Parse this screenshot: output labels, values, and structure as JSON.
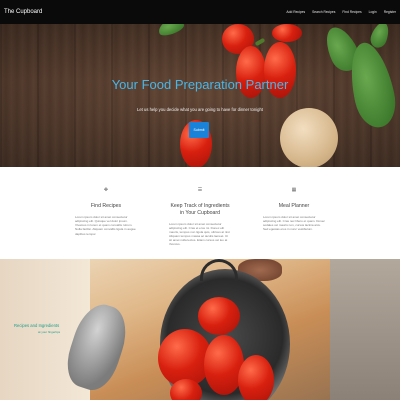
{
  "navbar": {
    "brand": "The Cupboard",
    "links": [
      "Add Recipes",
      "Search Recipes",
      "Find Recipes",
      "Login",
      "Register"
    ]
  },
  "hero": {
    "title": "Your Food Preparation Partner",
    "subtitle": "Let us help you decide what you are going to have for dinner tonight",
    "button_label": "Submit"
  },
  "features": [
    {
      "icon": "fork-knife-icon",
      "glyph": "✥",
      "title": "Find Recipes",
      "description": "Lorem ipsum dolor sit amet consectetur adipiscing elit. Quisque vel dolor ipsum. Vivamus in lorem et quam convallis rutrum. Nulla facilisi. Aliquam convallis ligula in augue dapibus tempor."
    },
    {
      "icon": "list-icon",
      "glyph": "☰",
      "title": "Keep Track of Ingredients in Your Cupboard",
      "description": "Lorem ipsum dolor sit amet consectetur adipiscing elit. Cras et eros mi. Donec elit mauris, tempus non ligula quis, ultrices at nisl. Aliquam tempus massa ac iaculis laoreet. Ut sit amet nulla lectus. Etiam cursus vel leo at rhoncus."
    },
    {
      "icon": "calendar-icon",
      "glyph": "▦",
      "title": "Meal Planner",
      "description": "Lorem ipsum dolor sit amet consectetur adipiscing elit. Cras nec libero et quam. Donec sodales vel mauris non, cursus lacinia arcu. Sed egestas eros in nunc vestibulum."
    }
  ],
  "bottom": {
    "title": "Recipes and Ingredients",
    "subtitle": "at your fingertips"
  }
}
